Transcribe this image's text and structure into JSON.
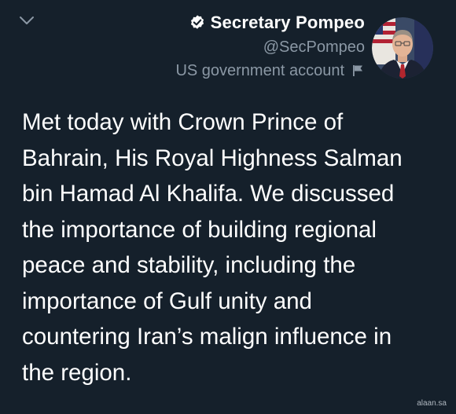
{
  "header": {
    "display_name": "Secretary Pompeo",
    "handle": "@SecPompeo",
    "account_label": "US government account"
  },
  "icons": {
    "collapse": "chevron-down-icon",
    "verified": "verified-badge-icon",
    "label_flag": "flag-icon"
  },
  "tweet": {
    "text": "Met today with Crown Prince of\nBahrain, His Royal Highness Salman\nbin Hamad Al Khalifa. We discussed\nthe importance of building regional\npeace and stability, including the\nimportance of Gulf unity and\ncountering Iran’s malign influence in\nthe region."
  },
  "watermark": "alaan.sa",
  "colors": {
    "background": "#15202b",
    "primary_text": "#ffffff",
    "secondary_text": "#8b98a5",
    "verified_badge": "#ffffff"
  }
}
